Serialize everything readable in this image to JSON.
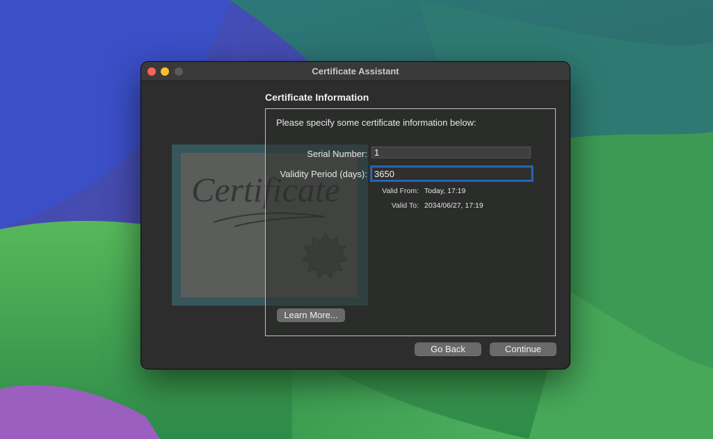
{
  "window": {
    "title": "Certificate Assistant"
  },
  "section": {
    "title": "Certificate Information"
  },
  "panel": {
    "intro": "Please specify some certificate information below:",
    "serial_label": "Serial Number:",
    "serial_value": "1",
    "validity_label": "Validity Period (days):",
    "validity_value": "3650",
    "valid_from_label": "Valid From:",
    "valid_from_value": "Today, 17:19",
    "valid_to_label": "Valid To:",
    "valid_to_value": "2034/06/27, 17:19",
    "learn_more_label": "Learn More..."
  },
  "footer": {
    "go_back_label": "Go Back",
    "continue_label": "Continue"
  },
  "art": {
    "certificate_word": "Certificate"
  },
  "colors": {
    "accent": "#2f76c4",
    "close": "#fe5f57",
    "minimize": "#febc2e"
  }
}
